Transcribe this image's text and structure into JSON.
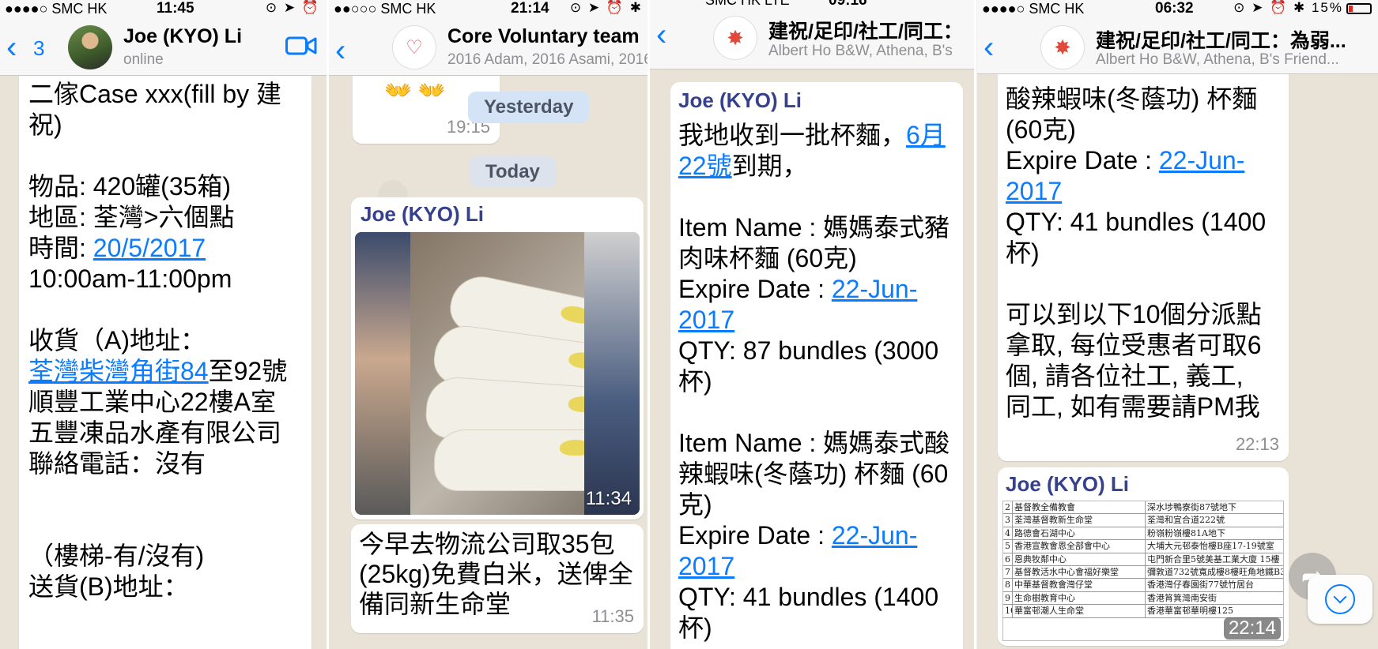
{
  "screen1": {
    "status": {
      "carrier": "●●●●○ SMC HK",
      "time": "11:45"
    },
    "nav": {
      "back_count": "3",
      "title": "Joe (KYO) Li",
      "subtitle": "online"
    },
    "message": {
      "line1": "二傢Case xxx(fill by 建祝)",
      "item": "物品: 420罐(35箱)",
      "area": "地區: 荃灣>六個點",
      "time_label": "時間: ",
      "date_link": "20/5/2017",
      "time_range": "10:00am-11:00pm",
      "pickup_label": "收貨（A)地址：",
      "address_link": "荃灣柴灣角街84",
      "address_rest": "至92號順豐工業中心22樓A室",
      "company": "五豐凍品水產有限公司",
      "phone": "聯絡電話：沒有",
      "stairs": "（樓梯-有/沒有)",
      "delivery_label": "送貨(B)地址："
    }
  },
  "screen2": {
    "status": {
      "carrier": "●●○○○ SMC HK",
      "time": "21:14"
    },
    "nav": {
      "title": "Core Voluntary team",
      "subtitle": "2016 Adam, 2016 Asami, 2016"
    },
    "top_bubble_time": "19:15",
    "day_yesterday": "Yesterday",
    "day_today": "Today",
    "photo_msg": {
      "sender": "Joe (KYO) Li",
      "time": "11:34"
    },
    "text_msg": {
      "text": "今早去物流公司取35包(25kg)免費白米，送俾全備同新生命堂",
      "time": "11:35"
    }
  },
  "screen3": {
    "status": {
      "carrier": "SMC HK  LTE",
      "time": "09:16"
    },
    "nav": {
      "title": "建祝/足印/社工/同工：",
      "subtitle": "Albert Ho B&W, Athena, B's"
    },
    "message": {
      "sender": "Joe (KYO) Li",
      "intro": "我地收到一批杯麵，",
      "intro_link": "6月22號",
      "intro_end": "到期，",
      "item1_name": "Item Name : 媽媽泰式豬肉味杯麵 (60克)",
      "item1_exp_label": "Expire Date : ",
      "item1_exp": "22-Jun-2017",
      "item1_qty": "QTY: 87 bundles (3000 杯)",
      "item2_name": "Item Name : 媽媽泰式酸辣蝦味(冬蔭功) 杯麵 (60克)",
      "item2_exp_label": "Expire Date : ",
      "item2_exp": "22-Jun-2017",
      "item2_qty": "QTY: 41 bundles (1400 杯)"
    }
  },
  "screen4": {
    "status": {
      "carrier": "●●●●○ SMC HK",
      "time": "06:32",
      "battery": "15%"
    },
    "nav": {
      "title": "建祝/足印/社工/同工：為弱...",
      "subtitle": "Albert Ho B&W, Athena, B's Friend..."
    },
    "message1": {
      "item_name": "酸辣蝦味(冬蔭功) 杯麵 (60克)",
      "exp_label": "Expire Date : ",
      "exp": "22-Jun-2017",
      "qty": "QTY: 41 bundles (1400 杯)",
      "note": "可以到以下10個分派點拿取, 每位受惠者可取6個, 請各位社工, 義工, 同工, 如有需要請PM我",
      "time": "22:13"
    },
    "message2": {
      "sender": "Joe (KYO) Li",
      "time": "22:14",
      "rows": [
        [
          "2",
          "基督教全備教會",
          "深水埗鴨寮街87號地下"
        ],
        [
          "3",
          "荃灣基督教新生命堂",
          "荃灣和宜合道222號"
        ],
        [
          "4",
          "路德會石湖中心",
          "粉嶺粉嶺樓81A地下"
        ],
        [
          "5",
          "香港宣教會恩全部會中心",
          "大埔大元邨泰怡樓B座17-19號室"
        ],
        [
          "6",
          "恩典牧鄰中心",
          "屯門新合里5號美基工業大廈 15樓"
        ],
        [
          "7",
          "基督教活水中心會福好樂堂",
          "彌敦道732號寬成樓8樓旺角地鐵B3"
        ],
        [
          "8",
          "中華基督教會灣仔堂",
          "香港灣仔春園街77號竹居台"
        ],
        [
          "9",
          "生命樹教育中心",
          "香港筲箕灣南安街"
        ],
        [
          "10",
          "華富邨潮人生命堂",
          "香港華富邨華明樓125"
        ]
      ]
    }
  }
}
